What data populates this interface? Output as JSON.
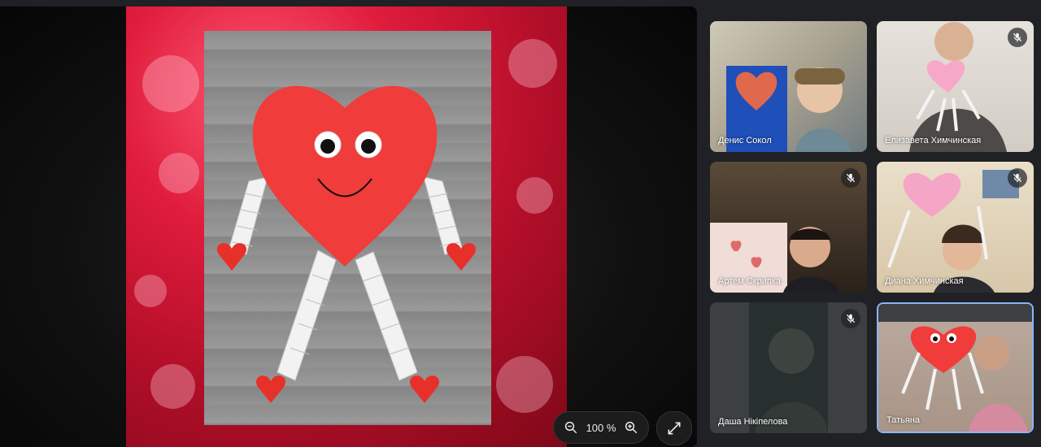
{
  "zoom": {
    "value": "100 %"
  },
  "participants": [
    {
      "name": "Денис Сокол",
      "muted": false
    },
    {
      "name": "Елизавета Химчинская",
      "muted": true
    },
    {
      "name": "Артем Скрипка",
      "muted": true
    },
    {
      "name": "Диана Химчинская",
      "muted": true
    },
    {
      "name": "Даша Нікіпелова",
      "muted": true
    },
    {
      "name": "Татьяна",
      "muted": false
    }
  ],
  "colors": {
    "accent": "#8ab4f8",
    "heart": "#f03c3a",
    "background": "#202124"
  }
}
